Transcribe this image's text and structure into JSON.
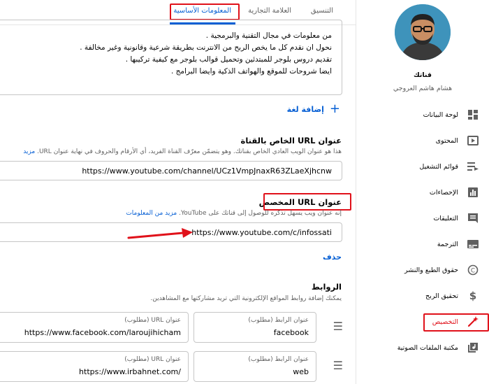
{
  "tabs": {
    "basic_info": "المعلومات الأساسية",
    "branding": "العلامة التجارية",
    "layout": "التنسيق"
  },
  "description": {
    "lines": [
      "من معلومات في مجال التقنية والبرمجية .",
      "نحول ان نقدم كل ما يخص الربح من الانترنت بطريقة شرعية وقانونية وغير مخالفة .",
      "تقديم دروس بلوجر للمبتدئين وتحميل قوالب بلوجر مع كيفية تركيبها .",
      "ايضا شروحات للموقع والهواتف الذكية وايضا البرامج ."
    ]
  },
  "add_language": "إضافة لغة",
  "channel_url": {
    "title": "عنوان URL الخاص بالقناة",
    "desc": "هذا هو عنوان الويب العادي الخاص بقناتك. وهو يتضمّن معرّف القناة الفريد، أي الأرقام والحروف في نهاية عنوان URL.",
    "more": "مزيد",
    "value": "https://www.youtube.com/channel/UCz1VmpJnaxR63ZLaeXjhcnw"
  },
  "custom_url": {
    "title": "عنوان URL المخصص",
    "desc": "إنه عنوان ويب يسهل تذكره للوصول إلى قناتك على YouTube.",
    "more": "مزيد من المعلومات",
    "value": "https://www.youtube.com/c/infossati",
    "delete": "حذف"
  },
  "links": {
    "title": "الروابط",
    "desc": "يمكنك إضافة روابط المواقع الإلكترونية التي تريد مشاركتها مع المشاهدين.",
    "title_label": "عنوان الرابط (مطلوب)",
    "url_label": "عنوان URL (مطلوب)",
    "items": [
      {
        "title": "facebook",
        "url": "https://www.facebook.com/laroujihicham"
      },
      {
        "title": "web",
        "url": "/https://www.irbahnet.com"
      }
    ]
  },
  "sidebar": {
    "channel_title": "قناتك",
    "channel_name": "هشام هاشم العروجي",
    "items": [
      {
        "label": "لوحة البيانات",
        "icon": "dashboard-icon"
      },
      {
        "label": "المحتوى",
        "icon": "content-icon"
      },
      {
        "label": "قوائم التشغيل",
        "icon": "playlist-icon"
      },
      {
        "label": "الإحصاءات",
        "icon": "analytics-icon"
      },
      {
        "label": "التعليقات",
        "icon": "comments-icon"
      },
      {
        "label": "الترجمة",
        "icon": "subtitles-icon"
      },
      {
        "label": "حقوق الطبع والنشر",
        "icon": "copyright-icon"
      },
      {
        "label": "تحقيق الربح",
        "icon": "dollar-icon"
      },
      {
        "label": "التخصيص",
        "icon": "magic-wand-icon"
      },
      {
        "label": "مكتبة الملفات الصوتية",
        "icon": "audio-library-icon"
      }
    ]
  },
  "colors": {
    "accent": "#065fd4",
    "highlight": "#e0111a"
  }
}
